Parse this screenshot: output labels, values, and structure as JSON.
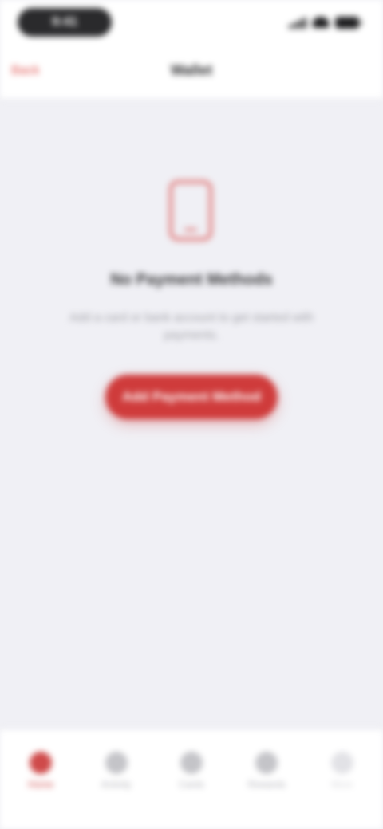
{
  "status_bar": {
    "time": "9:41"
  },
  "nav": {
    "back_label": "Back",
    "title": "Wallet"
  },
  "empty_state": {
    "icon": "phone-icon",
    "title": "No Payment Methods",
    "subtitle": "Add a card or bank account to get started with payments.",
    "button_label": "Add Payment Method"
  },
  "tab_bar": {
    "tabs": [
      {
        "label": "Home",
        "icon": "home-icon"
      },
      {
        "label": "Activity",
        "icon": "activity-icon"
      },
      {
        "label": "Cards",
        "icon": "cards-icon"
      },
      {
        "label": "Rewards",
        "icon": "rewards-icon"
      },
      {
        "label": "More",
        "icon": "more-icon"
      }
    ]
  },
  "colors": {
    "accent": "#cf3b3b",
    "background": "#f0f0f5"
  }
}
